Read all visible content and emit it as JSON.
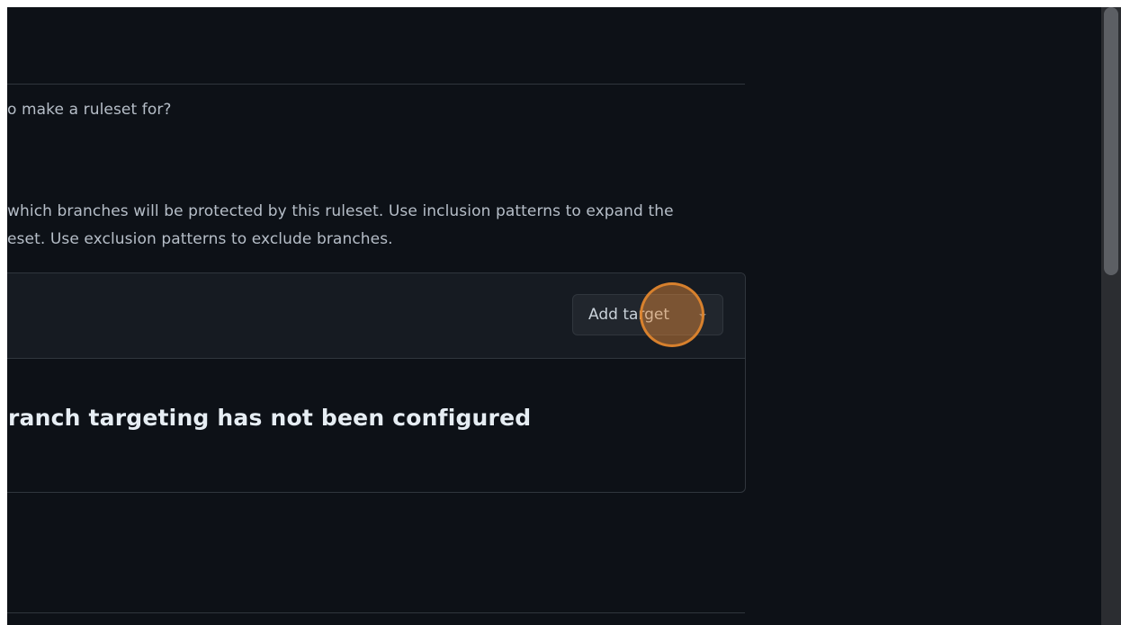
{
  "target_section": {
    "question": "o make a ruleset for?",
    "description_line1": "which branches will be protected by this ruleset. Use inclusion patterns to expand the",
    "description_line2": "eset. Use exclusion patterns to exclude branches."
  },
  "targets_panel": {
    "add_target_label": "Add target",
    "add_target_icon": "chevron-down-icon",
    "empty_title": "ranch targeting has not been configured"
  },
  "click_marker": {
    "color": "#e88f3c"
  },
  "colors": {
    "background": "#0d1117",
    "panel_header": "#161b22",
    "border": "#30363d",
    "button_bg": "#21262d",
    "text_muted": "#b6bec8",
    "text_strong": "#e6edf3"
  }
}
